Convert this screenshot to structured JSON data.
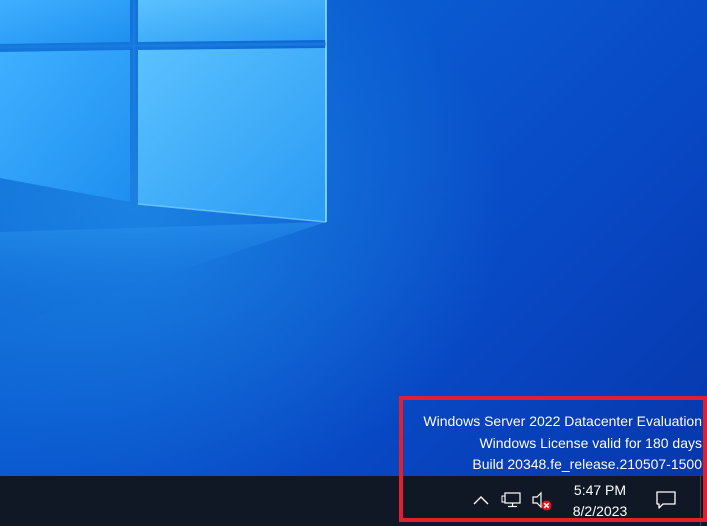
{
  "watermark": {
    "line1": "Windows Server 2022 Datacenter Evaluation",
    "line2": "Windows License valid for 180 days",
    "line3": "Build 20348.fe_release.210507-1500"
  },
  "clock": {
    "time": "5:47 PM",
    "date": "8/2/2023"
  },
  "tray": {
    "icons": [
      "chevron-up-icon",
      "network-icon",
      "volume-muted-icon",
      "notification-icon"
    ]
  },
  "colors": {
    "desktop_accent": "#0a5ad0",
    "taskbar": "#101826",
    "highlight": "#e0202e",
    "mute_badge": "#e81123"
  }
}
